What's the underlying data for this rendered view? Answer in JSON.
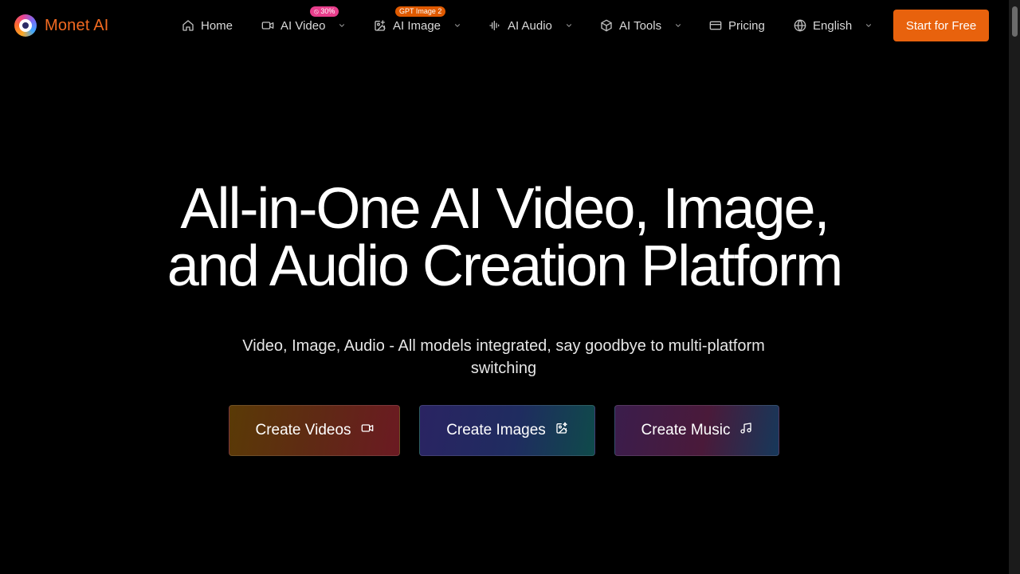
{
  "brand": {
    "name": "Monet AI",
    "color": "#f26a21"
  },
  "nav": {
    "items": [
      {
        "label": "Home",
        "icon": "home-icon"
      },
      {
        "label": "AI Video",
        "icon": "video-camera-icon",
        "badge": "30%",
        "badge_icon": "tag-icon",
        "badge_color": "#e83e8c"
      },
      {
        "label": "AI Image",
        "icon": "image-edit-icon",
        "badge": "GPT Image 2",
        "badge_color": "#e05a00"
      },
      {
        "label": "AI Audio",
        "icon": "audio-waveform-icon"
      },
      {
        "label": "AI Tools",
        "icon": "cube-icon"
      },
      {
        "label": "Pricing",
        "icon": "credit-card-icon"
      },
      {
        "label": "English",
        "icon": "globe-icon"
      }
    ],
    "cta_label": "Start for Free",
    "cta_color": "#e8620d"
  },
  "hero": {
    "title_line1": "All-in-One AI Video, Image,",
    "title_line2": "and Audio Creation Platform",
    "subtitle": "Video, Image, Audio - All models integrated, say goodbye to multi-platform switching",
    "buttons": [
      {
        "label": "Create Videos",
        "icon": "video-camera-icon"
      },
      {
        "label": "Create Images",
        "icon": "image-sparkle-icon"
      },
      {
        "label": "Create Music",
        "icon": "music-note-icon"
      }
    ]
  }
}
